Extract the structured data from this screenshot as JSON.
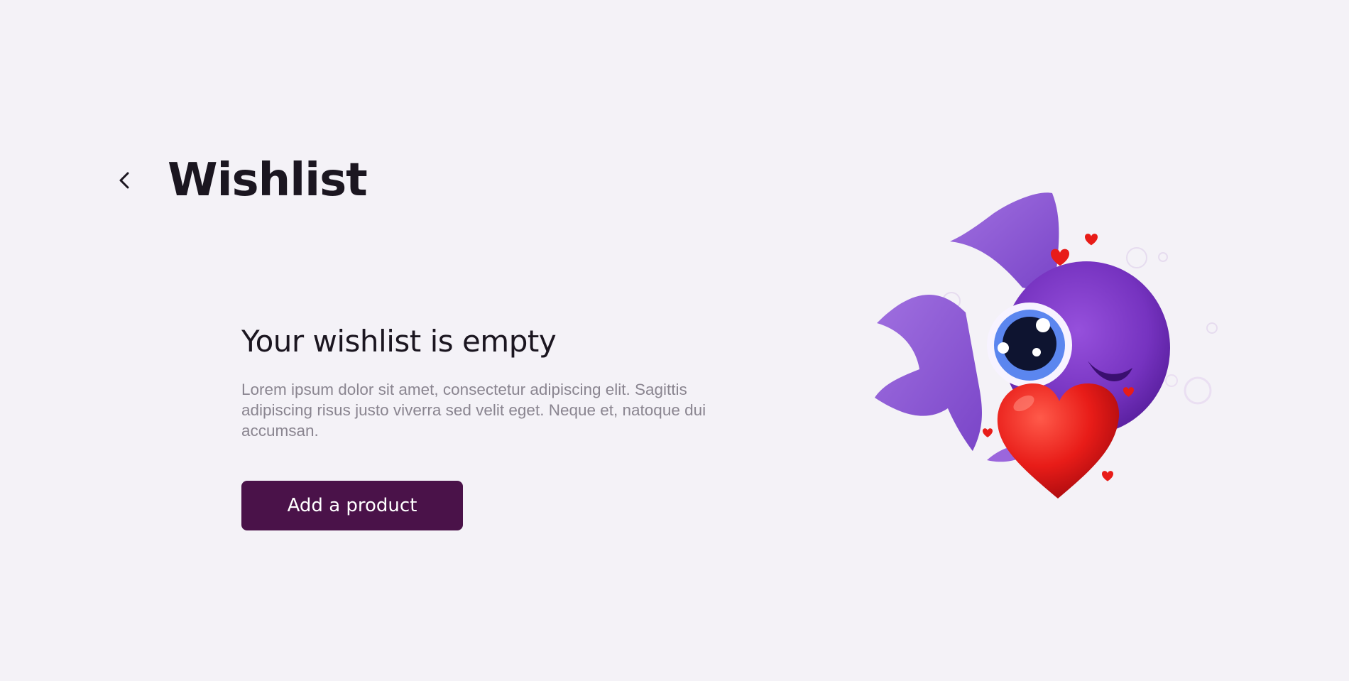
{
  "header": {
    "back_icon": "chevron-left-icon",
    "title": "Wishlist"
  },
  "empty_state": {
    "title": "Your wishlist is empty",
    "description": "Lorem ipsum dolor sit amet, consectetur adipiscing elit. Sagittis adipiscing risus justo viverra sed velit eget. Neque et, natoque dui accumsan.",
    "button_label": "Add a product",
    "illustration": "fish-with-heart-illustration"
  },
  "colors": {
    "background": "#f4f2f7",
    "title_text": "#1b1620",
    "body_text": "#8a8590",
    "button_bg": "#4a1249",
    "button_text": "#ffffff",
    "fish_purple": "#7b3fc4",
    "heart_red": "#e8201c"
  }
}
